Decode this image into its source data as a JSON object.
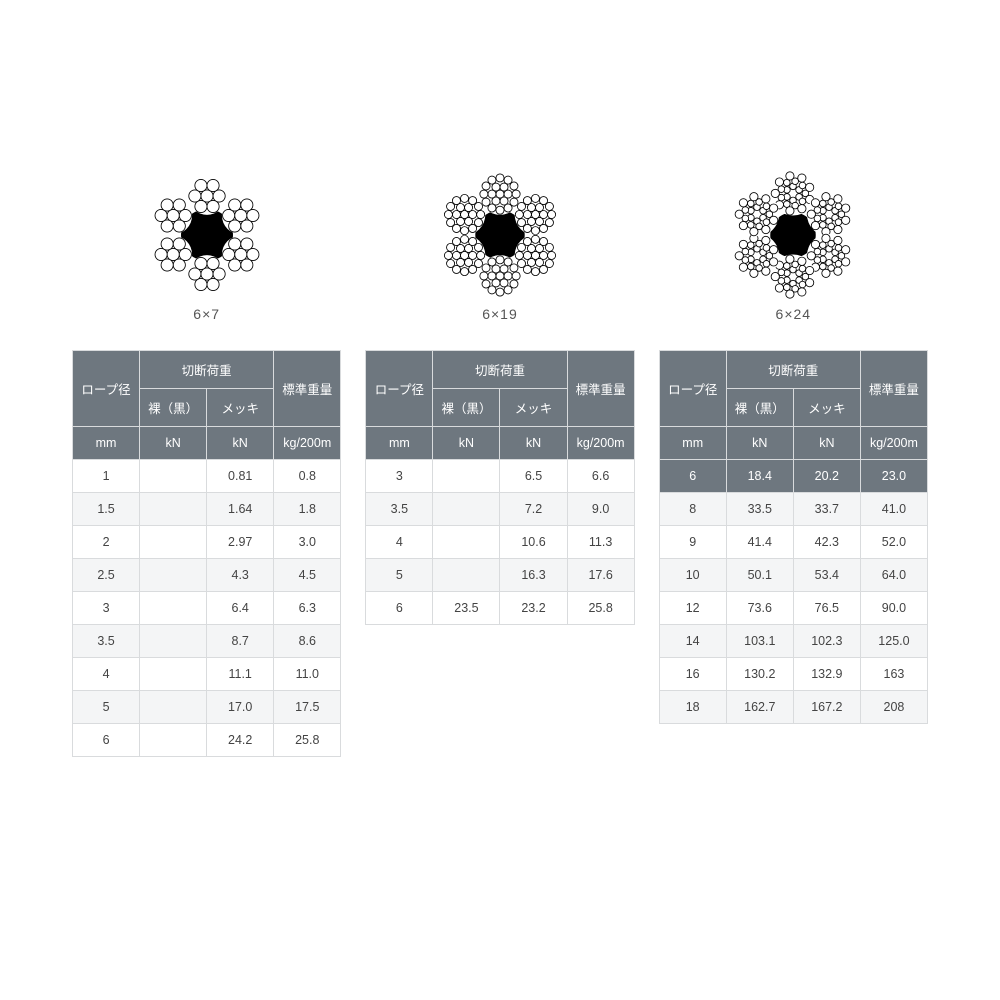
{
  "headers": {
    "diameter": "ロープ径",
    "breaking": "切断荷重",
    "bare": "裸（黒）",
    "plated": "メッキ",
    "weight": "標準重量",
    "mm": "mm",
    "kn": "kN",
    "kg": "kg/200m"
  },
  "sections": [
    {
      "label": "6×7",
      "diagram": "6x7",
      "rows": [
        {
          "d": "1",
          "bare": "",
          "plated": "0.81",
          "w": "0.8"
        },
        {
          "d": "1.5",
          "bare": "",
          "plated": "1.64",
          "w": "1.8"
        },
        {
          "d": "2",
          "bare": "",
          "plated": "2.97",
          "w": "3.0"
        },
        {
          "d": "2.5",
          "bare": "",
          "plated": "4.3",
          "w": "4.5"
        },
        {
          "d": "3",
          "bare": "",
          "plated": "6.4",
          "w": "6.3"
        },
        {
          "d": "3.5",
          "bare": "",
          "plated": "8.7",
          "w": "8.6"
        },
        {
          "d": "4",
          "bare": "",
          "plated": "11.1",
          "w": "11.0"
        },
        {
          "d": "5",
          "bare": "",
          "plated": "17.0",
          "w": "17.5"
        },
        {
          "d": "6",
          "bare": "",
          "plated": "24.2",
          "w": "25.8"
        }
      ]
    },
    {
      "label": "6×19",
      "diagram": "6x19",
      "rows": [
        {
          "d": "3",
          "bare": "",
          "plated": "6.5",
          "w": "6.6"
        },
        {
          "d": "3.5",
          "bare": "",
          "plated": "7.2",
          "w": "9.0"
        },
        {
          "d": "4",
          "bare": "",
          "plated": "10.6",
          "w": "11.3"
        },
        {
          "d": "5",
          "bare": "",
          "plated": "16.3",
          "w": "17.6"
        },
        {
          "d": "6",
          "bare": "23.5",
          "plated": "23.2",
          "w": "25.8"
        }
      ]
    },
    {
      "label": "6×24",
      "diagram": "6x24",
      "rows": [
        {
          "d": "6",
          "bare": "18.4",
          "plated": "20.2",
          "w": "23.0",
          "hi": true
        },
        {
          "d": "8",
          "bare": "33.5",
          "plated": "33.7",
          "w": "41.0"
        },
        {
          "d": "9",
          "bare": "41.4",
          "plated": "42.3",
          "w": "52.0"
        },
        {
          "d": "10",
          "bare": "50.1",
          "plated": "53.4",
          "w": "64.0"
        },
        {
          "d": "12",
          "bare": "73.6",
          "plated": "76.5",
          "w": "90.0"
        },
        {
          "d": "14",
          "bare": "103.1",
          "plated": "102.3",
          "w": "125.0"
        },
        {
          "d": "16",
          "bare": "130.2",
          "plated": "132.9",
          "w": "163"
        },
        {
          "d": "18",
          "bare": "162.7",
          "plated": "167.2",
          "w": "208"
        }
      ]
    }
  ]
}
